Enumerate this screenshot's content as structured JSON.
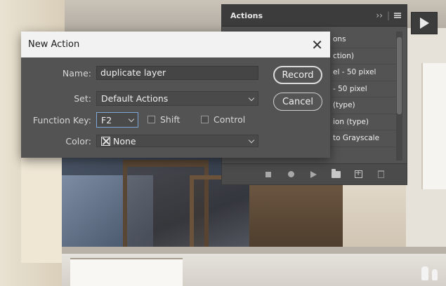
{
  "actions_panel": {
    "tab_label": "Actions",
    "collapse_glyph": "››",
    "items": [
      "ons",
      "ction)",
      "el - 50 pixel",
      " - 50 pixel",
      "(type)",
      "ion (type)",
      "to Grayscale"
    ],
    "toolbar_icons": [
      "stop-icon",
      "record-icon",
      "play-icon",
      "new-set-folder-icon",
      "new-action-icon",
      "delete-icon"
    ]
  },
  "new_action_dialog": {
    "title": "New Action",
    "close_glyph": "✕",
    "name_label": "Name:",
    "name_value": "duplicate layer",
    "set_label": "Set:",
    "set_value": "Default Actions",
    "function_key_label": "Function Key:",
    "function_key_value": "F2",
    "shift_label": "Shift",
    "control_label": "Control",
    "color_label": "Color:",
    "color_value": "None",
    "record_button": "Record",
    "cancel_button": "Cancel"
  },
  "colors": {
    "panel_bg": "#535353",
    "title_bar_bg": "#f2f2f2",
    "text_light": "#efefef"
  }
}
